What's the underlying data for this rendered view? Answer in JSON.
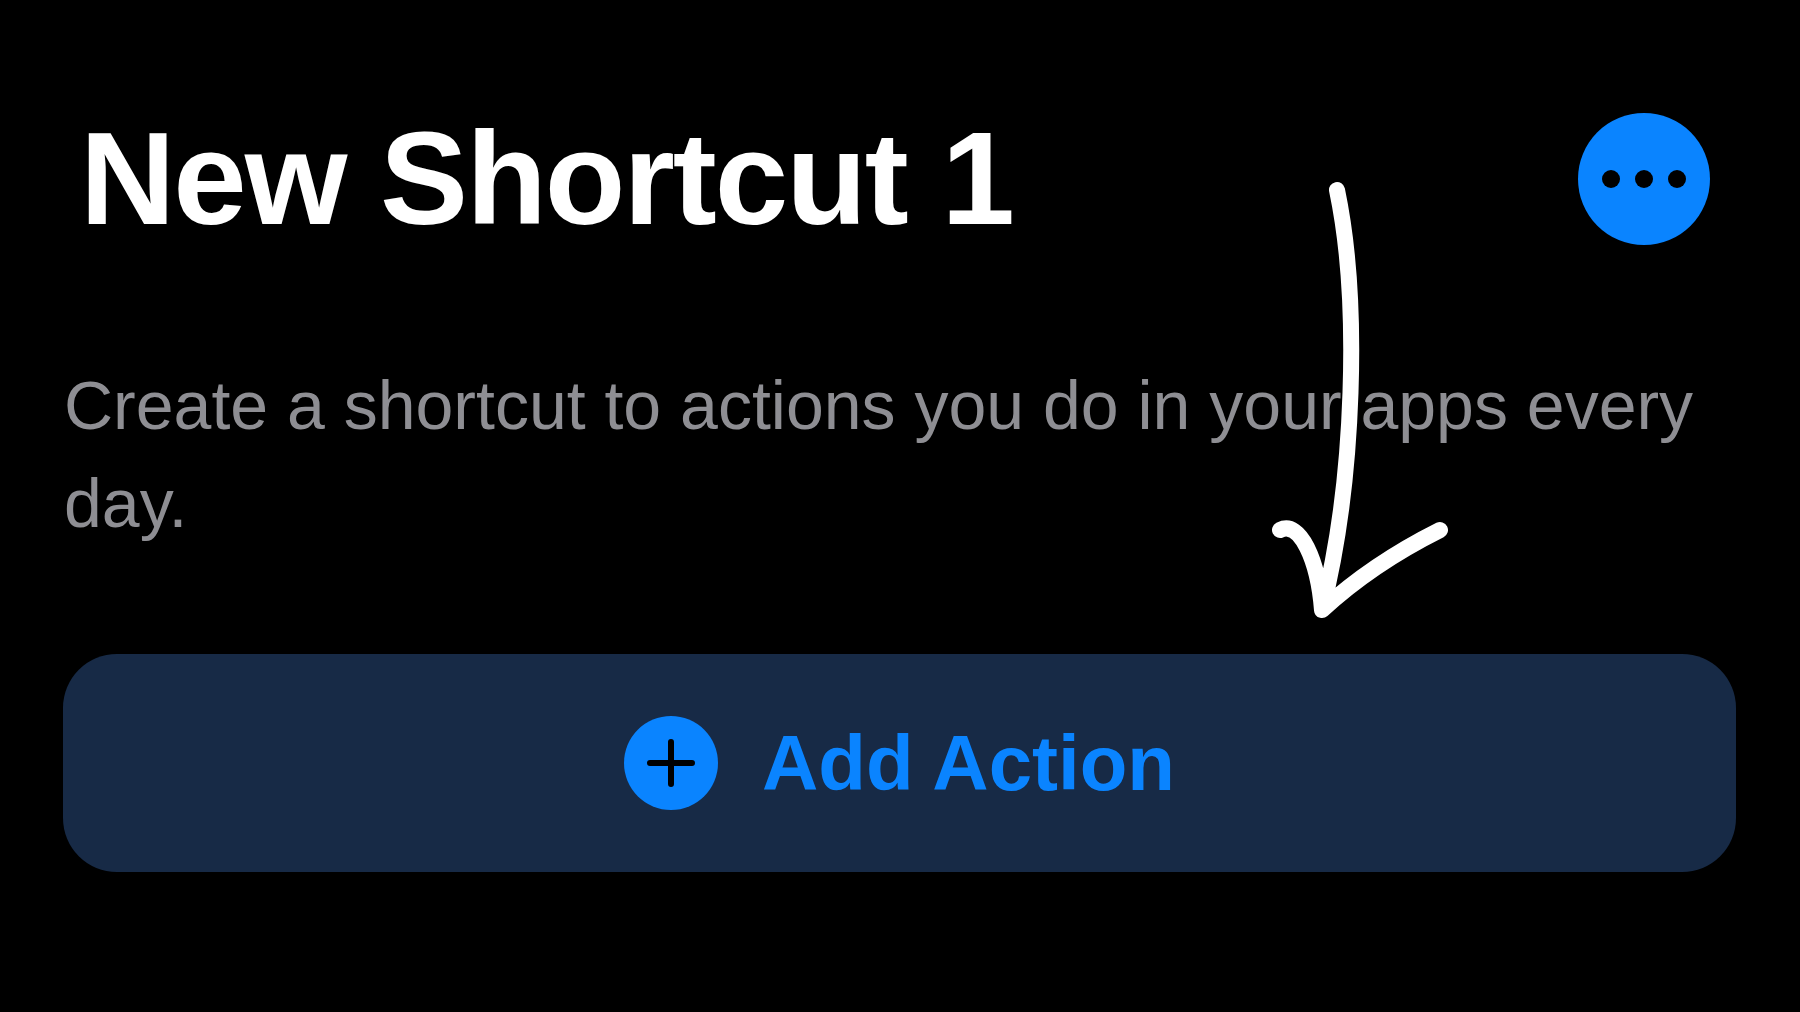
{
  "title": "New Shortcut 1",
  "description": "Create a shortcut to actions you do in your apps every day.",
  "add_button": {
    "label": "Add Action"
  }
}
